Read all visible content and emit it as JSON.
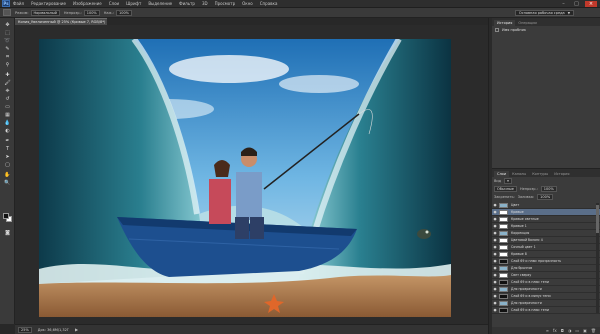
{
  "app": {
    "logo": "Ps"
  },
  "menu": [
    "Файл",
    "Редактирование",
    "Изображение",
    "Слои",
    "Шрифт",
    "Выделение",
    "Фильтр",
    "3D",
    "Просмотр",
    "Окно",
    "Справка"
  ],
  "options": {
    "mode_label": "Режим:",
    "mode_value": "Нормальный",
    "opacity_label": "Непрозр.:",
    "opacity_value": "100%",
    "flow_label": "Наж.:",
    "flow_value": "100%"
  },
  "workspace": {
    "value": "Основная рабочая среда"
  },
  "document": {
    "tab_title": "Копия_Увеличенный @ 25% (Кривые 7, RGB/8*)",
    "close": "×"
  },
  "status": {
    "zoom": "25%",
    "info": "Док: 36,6M/1,32Г",
    "arrow": "▶"
  },
  "history_panel": {
    "tabs": [
      "История",
      "Операции"
    ],
    "items": [
      "Имя пробник"
    ]
  },
  "layers_panel": {
    "tabs": [
      "Слои",
      "Каналы",
      "Контуры",
      "История"
    ],
    "blend_mode": "Обычные",
    "opacity_label": "Непрозр.:",
    "opacity_value": "100%",
    "kind_label": "Вид",
    "fill_label": "Заливка:",
    "fill_value": "100%",
    "lock_label": "Закрепить:",
    "layers": [
      {
        "name": "Цвет",
        "selected": false
      },
      {
        "name": "Кривые",
        "selected": true
      },
      {
        "name": "Кривые светлые",
        "selected": false
      },
      {
        "name": "Кривые 1",
        "selected": false
      },
      {
        "name": "Коррекция",
        "selected": false
      },
      {
        "name": "Цветовой баланс 4",
        "selected": false
      },
      {
        "name": "Сочный цвет 1",
        "selected": false
      },
      {
        "name": "Кривые 8",
        "selected": false
      },
      {
        "name": "Слой 69 и плюс прозрачность",
        "selected": false
      },
      {
        "name": "Для брызгов",
        "selected": false
      },
      {
        "name": "Свет сверху",
        "selected": false
      },
      {
        "name": "Слой 69 и в плюс тени",
        "selected": false
      },
      {
        "name": "Для прозрачности",
        "selected": false
      },
      {
        "name": "Слой 69 и в минус тени",
        "selected": false
      },
      {
        "name": "Для прозрачности",
        "selected": false
      },
      {
        "name": "Слой 69 и в плюс тени",
        "selected": false
      }
    ]
  },
  "colors": {
    "accent": "#5a6e89",
    "close": "#c0392b"
  }
}
